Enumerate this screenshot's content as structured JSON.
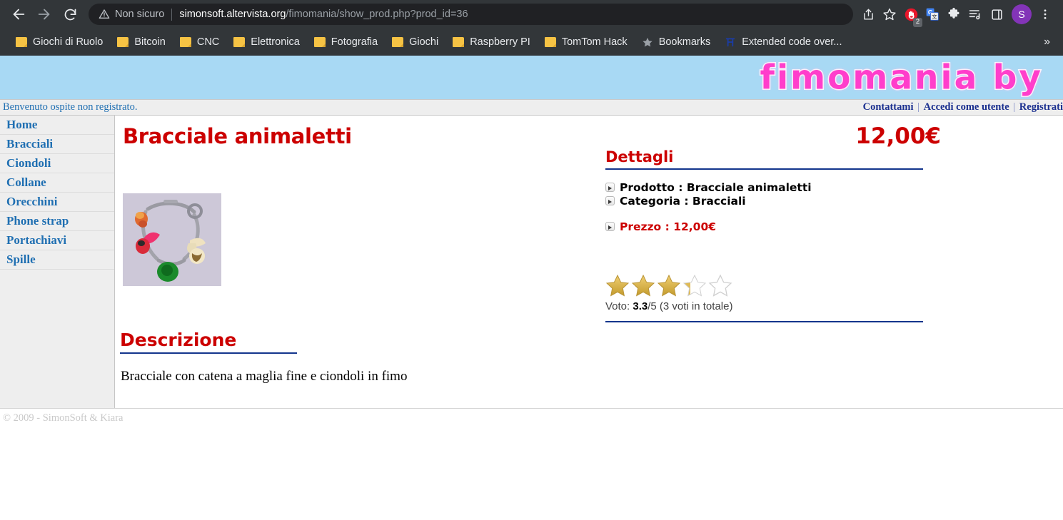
{
  "browser": {
    "security_label": "Non sicuro",
    "url_host": "simonsoft.altervista.org",
    "url_path": "/fimomania/show_prod.php?prod_id=36",
    "back_icon": "back-arrow-icon",
    "forward_icon": "forward-arrow-icon",
    "reload_icon": "reload-icon",
    "warning_icon": "warning-triangle-icon",
    "share_icon": "share-icon",
    "bookmark_icon": "star-outline-icon",
    "adblock_icon": "stop-hand-icon",
    "adblock_badge": "2",
    "translate_icon": "google-translate-icon",
    "extensions_icon": "puzzle-piece-icon",
    "reading_list_icon": "reading-list-icon",
    "side_panel_icon": "side-panel-icon",
    "profile_initial": "S",
    "menu_icon": "three-dot-menu-icon",
    "bookmarks": [
      {
        "label": "Giochi di Ruolo",
        "icon": "folder-icon"
      },
      {
        "label": "Bitcoin",
        "icon": "folder-icon"
      },
      {
        "label": "CNC",
        "icon": "folder-icon"
      },
      {
        "label": "Elettronica",
        "icon": "folder-icon"
      },
      {
        "label": "Fotografia",
        "icon": "folder-icon"
      },
      {
        "label": "Giochi",
        "icon": "folder-icon"
      },
      {
        "label": "Raspberry PI",
        "icon": "folder-icon"
      },
      {
        "label": "TomTom Hack",
        "icon": "folder-icon"
      },
      {
        "label": "Bookmarks",
        "icon": "star-icon"
      },
      {
        "label": "Extended code over...",
        "icon": "site-favicon"
      }
    ],
    "bookmarks_overflow": "»"
  },
  "site": {
    "logo_text": "fimomania by",
    "banner_color": "#a8d9f4",
    "accent_color": "#cc0000",
    "link_color": "#1f6fb2",
    "rule_color": "#13358c",
    "welcome_text": "Benvenuto ospite non registrato.",
    "account_links": [
      {
        "label": "Contattami"
      },
      {
        "label": "Accedi come utente"
      },
      {
        "label": "Registrati"
      }
    ],
    "sidebar": [
      {
        "label": "Home"
      },
      {
        "label": "Bracciali"
      },
      {
        "label": "Ciondoli"
      },
      {
        "label": "Collane"
      },
      {
        "label": "Orecchini"
      },
      {
        "label": "Phone strap"
      },
      {
        "label": "Portachiavi"
      },
      {
        "label": "Spille"
      }
    ],
    "footer": "© 2009 - SimonSoft & Kiara"
  },
  "product": {
    "title": "Bracciale animaletti",
    "price": "12,00€",
    "photo_alt": "bracciale-con-ciondoli-in-fimo",
    "details_heading": "Dettagli",
    "details": [
      {
        "label": "Prodotto",
        "value": "Bracciale animaletti"
      },
      {
        "label": "Categoria",
        "value": "Bracciali"
      }
    ],
    "price_detail": {
      "label": "Prezzo",
      "value": "12,00€"
    },
    "rating": {
      "score": "3.3",
      "max": "5",
      "stars_filled": 3.3,
      "vote_prefix": "Voto: ",
      "vote_suffix": "/5 (3 voti in totale)",
      "votes_count": 3
    },
    "description_heading": "Descrizione",
    "description": "Bracciale con catena a maglia fine e ciondoli in fimo"
  }
}
